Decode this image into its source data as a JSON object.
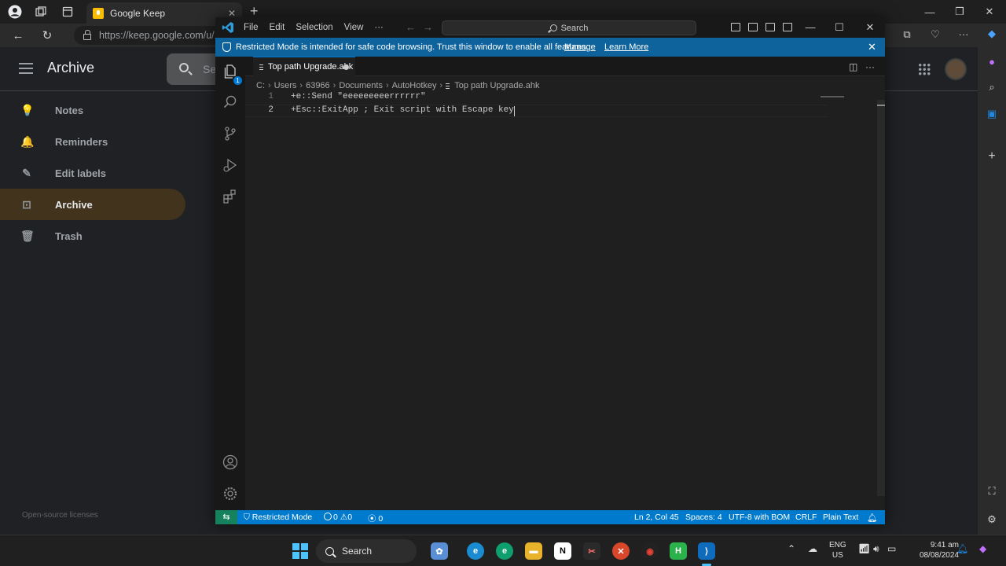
{
  "browser": {
    "tab_title": "Google Keep",
    "url": "https://keep.google.com/u/1/",
    "new_tab_symbol": "+"
  },
  "keep": {
    "page_title": "Archive",
    "search_placeholder": "Se",
    "nav": [
      {
        "label": "Notes",
        "icon": "lightbulb-icon",
        "glyph": "💡"
      },
      {
        "label": "Reminders",
        "icon": "bell-icon",
        "glyph": "🔔"
      },
      {
        "label": "Edit labels",
        "icon": "pencil-icon",
        "glyph": "✎"
      },
      {
        "label": "Archive",
        "icon": "archive-icon",
        "glyph": "⊡",
        "active": true
      },
      {
        "label": "Trash",
        "icon": "trash-icon",
        "glyph": "🗑"
      }
    ],
    "footer": "Open-source licenses",
    "active_color": "#41331c"
  },
  "vscode": {
    "menu": [
      "File",
      "Edit",
      "Selection",
      "View",
      "···"
    ],
    "search_label": "Search",
    "banner": {
      "text": "Restricted Mode is intended for safe code browsing. Trust this window to enable all features.",
      "manage": "Manage",
      "learn_more": "Learn More"
    },
    "explorer_badge": "1",
    "tab_title": "Top path Upgrade.ahk",
    "breadcrumb": [
      "C:",
      "Users",
      "63966",
      "Documents",
      "AutoHotkey",
      "Top path Upgrade.ahk"
    ],
    "code_lines": [
      {
        "number": "1",
        "text": "+e::Send \"eeeeeeeeerrrrrr\""
      },
      {
        "number": "2",
        "text": "+Esc::ExitApp ; Exit script with Escape key"
      }
    ],
    "status": {
      "restricted": "Restricted Mode",
      "errors": "0",
      "warnings": "0",
      "ports": "0",
      "position": "Ln 2, Col 45",
      "spaces": "Spaces: 4",
      "encoding": "UTF-8 with BOM",
      "eol": "CRLF",
      "language": "Plain Text"
    },
    "accent_color": "#007acc",
    "banner_color": "#0e639c"
  },
  "taskbar": {
    "search_label": "Search",
    "lang_line1": "ENG",
    "lang_line2": "US",
    "time": "9:41 am",
    "date": "08/08/2024"
  }
}
